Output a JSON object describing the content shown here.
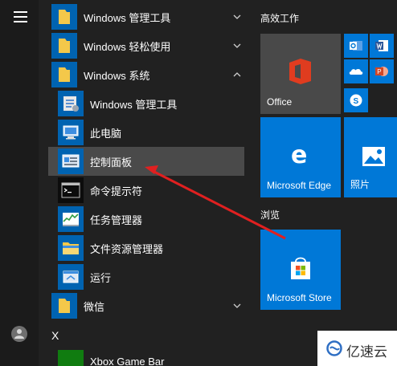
{
  "rail": {
    "menu_icon": "hamburger-menu-icon",
    "user_icon": "user-avatar-icon"
  },
  "app_list": {
    "rows": [
      {
        "label": "Windows 管理工具",
        "kind": "folder",
        "chevron": "down"
      },
      {
        "label": "Windows 轻松使用",
        "kind": "folder",
        "chevron": "down"
      },
      {
        "label": "Windows 系统",
        "kind": "folder",
        "chevron": "up"
      },
      {
        "label": "Windows 管理工具",
        "kind": "app",
        "icon": "admin-tools-icon"
      },
      {
        "label": "此电脑",
        "kind": "app",
        "icon": "this-pc-icon"
      },
      {
        "label": "控制面板",
        "kind": "app",
        "icon": "control-panel-icon",
        "selected": true
      },
      {
        "label": "命令提示符",
        "kind": "app",
        "icon": "command-prompt-icon"
      },
      {
        "label": "任务管理器",
        "kind": "app",
        "icon": "task-manager-icon"
      },
      {
        "label": "文件资源管理器",
        "kind": "app",
        "icon": "file-explorer-icon"
      },
      {
        "label": "运行",
        "kind": "app",
        "icon": "run-icon"
      },
      {
        "label": "微信",
        "kind": "folder",
        "chevron": "down"
      }
    ],
    "group_letter": "X",
    "last_item": "Xbox Game Bar"
  },
  "tiles": {
    "section_productivity": "高效工作",
    "section_browse": "浏览",
    "office": {
      "label": "Office",
      "color": "#494949"
    },
    "edge": {
      "label": "Microsoft Edge",
      "color": "#0078d7"
    },
    "photos": {
      "label": "照片",
      "color": "#0078d7"
    },
    "store": {
      "label": "Microsoft Store",
      "color": "#0078d7"
    },
    "mini_tiles": [
      "outlook-icon",
      "word-icon",
      "onedrive-icon",
      "powerpoint-icon",
      "skype-icon"
    ]
  },
  "annotation": {
    "arrow_color": "#e02020"
  },
  "watermark": {
    "text": "亿速云"
  },
  "colors": {
    "background": "#212121",
    "accent": "#0078d7",
    "folder_icon_bg": "#0063b1",
    "selected_row": "#4a4a4a"
  }
}
